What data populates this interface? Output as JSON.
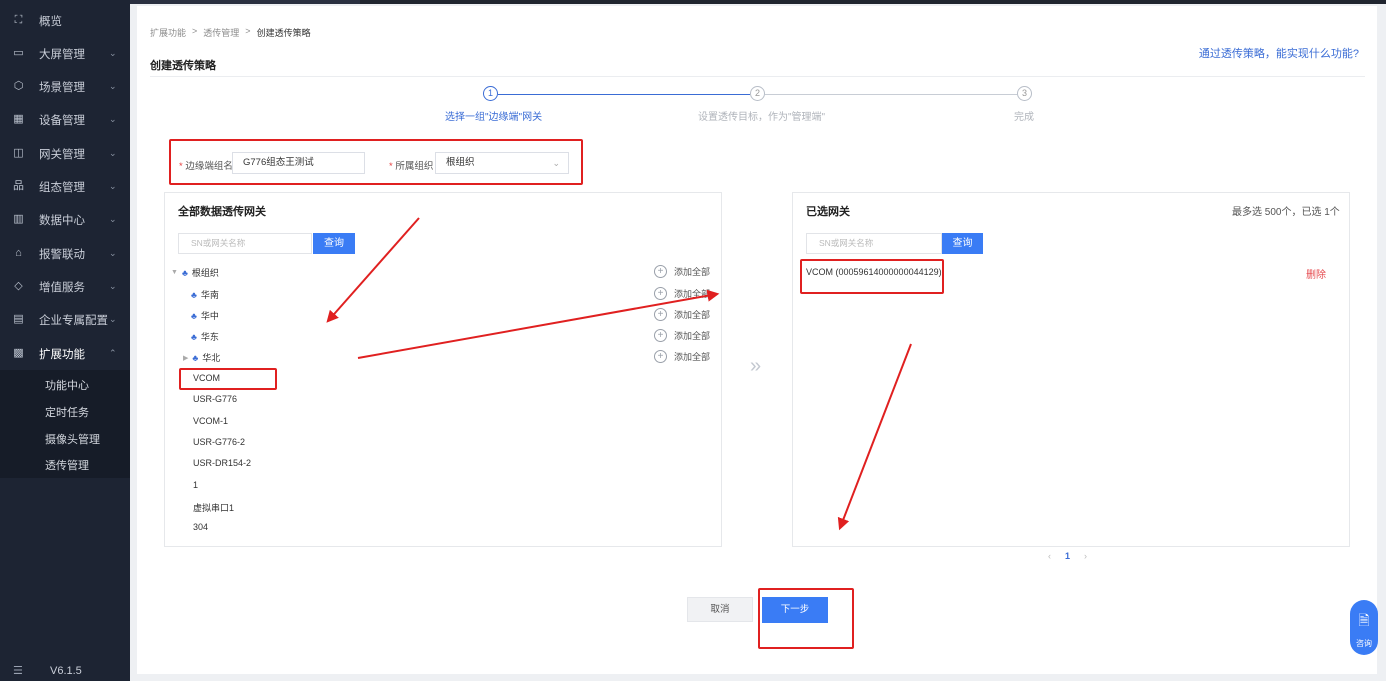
{
  "sidebar": {
    "items": [
      {
        "label": "概览",
        "icon": "overview-icon",
        "glyph": "⛶",
        "has_children": false
      },
      {
        "label": "大屏管理",
        "icon": "monitor-icon",
        "glyph": "▭",
        "has_children": true
      },
      {
        "label": "场景管理",
        "icon": "cube-icon",
        "glyph": "⬡",
        "has_children": true
      },
      {
        "label": "设备管理",
        "icon": "device-grid-icon",
        "glyph": "▦",
        "has_children": true
      },
      {
        "label": "网关管理",
        "icon": "gateway-icon",
        "glyph": "◫",
        "has_children": true
      },
      {
        "label": "组态管理",
        "icon": "hierarchy-icon",
        "glyph": "品",
        "has_children": true
      },
      {
        "label": "数据中心",
        "icon": "bar-chart-icon",
        "glyph": "▥",
        "has_children": true
      },
      {
        "label": "报警联动",
        "icon": "alarm-icon",
        "glyph": "⌂",
        "has_children": true
      },
      {
        "label": "增值服务",
        "icon": "diamond-icon",
        "glyph": "◇",
        "has_children": true
      },
      {
        "label": "企业专属配置",
        "icon": "building-icon",
        "glyph": "▤",
        "has_children": true
      },
      {
        "label": "扩展功能",
        "icon": "apps-icon",
        "glyph": "▩",
        "has_children": true,
        "open": true
      }
    ],
    "submenu": [
      "功能中心",
      "定时任务",
      "摄像头管理",
      "透传管理"
    ],
    "version": "V6.1.5",
    "chevron_down": "⌄",
    "chevron_up": "⌃",
    "collapse_glyph": "☰"
  },
  "breadcrumb": [
    "扩展功能",
    "透传管理",
    "创建透传策略"
  ],
  "breadcrumb_sep": ">",
  "page_title": "创建透传策略",
  "help_link": "通过透传策略，能实现什么功能?",
  "steps": [
    {
      "num": "1",
      "label": "选择一组\"边缘端\"网关",
      "active": true
    },
    {
      "num": "2",
      "label": "设置透传目标，作为\"管理端\"",
      "active": false
    },
    {
      "num": "3",
      "label": "完成",
      "active": false
    }
  ],
  "form": {
    "group_name_label": "边缘端组名",
    "group_name_value": "G776组态王测试",
    "org_label": "所属组织",
    "org_value": "根组织",
    "required_mark": "*"
  },
  "left_panel": {
    "title": "全部数据透传网关",
    "search_placeholder": "SN或网关名称",
    "search_button": "查询",
    "root_org": "根组织",
    "orgs": [
      "华南",
      "华中",
      "华东",
      "华北"
    ],
    "add_all": "添加全部",
    "gateways": [
      "VCOM",
      "USR-G776",
      "VCOM-1",
      "USR-G776-2",
      "USR-DR154-2",
      "1",
      "虚拟串口1",
      "304"
    ]
  },
  "transfer_glyph": "»",
  "right_panel": {
    "title": "已选网关",
    "limit_text": "最多选 500个，已选 1个",
    "search_placeholder": "SN或网关名称",
    "search_button": "查询",
    "selected": [
      {
        "name": "VCOM (00059614000000044129)",
        "action": "删除"
      }
    ]
  },
  "pager": {
    "prev": "‹",
    "current": "1",
    "next": "›"
  },
  "buttons": {
    "cancel": "取消",
    "next": "下一步"
  },
  "consult": {
    "label": "咨询",
    "glyph": "🗎"
  },
  "colors": {
    "accent": "#3a7cf5",
    "sidebar_bg": "#1d2433",
    "annotation": "#e02020",
    "danger": "#e5484d"
  }
}
